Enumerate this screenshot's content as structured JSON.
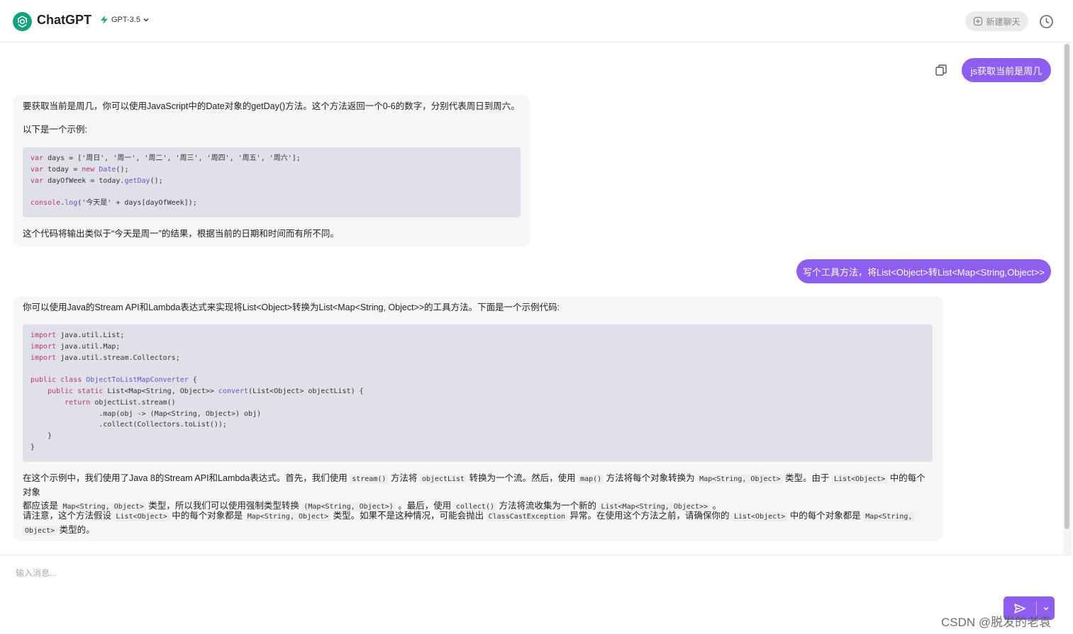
{
  "header": {
    "app_title": "ChatGPT",
    "model": "GPT-3.5",
    "new_chat": "新建聊天"
  },
  "messages": [
    {
      "role": "user",
      "text": "js获取当前是周几"
    },
    {
      "role": "assistant",
      "p1": "要获取当前是周几，你可以使用JavaScript中的Date对象的getDay()方法。这个方法返回一个0-6的数字，分别代表周日到周六。",
      "p2": "以下是一个示例:",
      "p3": "这个代码将输出类似于“今天是周一”的结果，根据当前的日期和时间而有所不同。"
    },
    {
      "role": "user",
      "text": "写个工具方法，将List<Object>转List<Map<String,Object>>"
    },
    {
      "role": "assistant",
      "p1": "你可以使用Java的Stream API和Lambda表达式来实现将List<Object>转换为List<Map<String, Object>>的工具方法。下面是一个示例代码:",
      "p2_a": "在这个示例中，我们使用了Java 8的Stream API和Lambda表达式。首先，我们使用",
      "p2_code1": "stream()",
      "p2_b": "方法将",
      "p2_code2": "objectList",
      "p2_c": "转换为一个流。然后，使用",
      "p2_code3": "map()",
      "p2_d": "方法将每个对象转换为",
      "p2_code4": "Map<String, Object>",
      "p2_e": "类型。由于",
      "p2_code5": "List<Object>",
      "p2_f": "中的每个对象",
      "p2_g": "都应该是",
      "p2_code6": "Map<String, Object>",
      "p2_h": "类型，所以我们可以使用强制类型转换",
      "p2_code7": "(Map<String, Object>)",
      "p2_i": "。最后，使用",
      "p2_code8": "collect()",
      "p2_j": "方法将流收集为一个新的",
      "p2_code9": "List<Map<String, Object>>",
      "p2_k": "。",
      "p3_a": "请注意，这个方法假设",
      "p3_code1": "List<Object>",
      "p3_b": "中的每个对象都是",
      "p3_code2": "Map<String, Object>",
      "p3_c": "类型。如果不是这种情况，可能会抛出",
      "p3_code3": "ClassCastException",
      "p3_d": "异常。在使用这个方法之前，请确保你的",
      "p3_code4": "List<Object>",
      "p3_e": "中的每个对象都是",
      "p3_code5": "Map<String,",
      "p3_code6": "Object>",
      "p3_f": "类型的。"
    }
  ],
  "code_js": {
    "l1_kw": "var",
    "l1_rest": " days = ['周日', '周一', '周二', '周三', '周四', '周五', '周六'];",
    "l2_kw": "var",
    "l2_a": " today = ",
    "l2_kw2": "new",
    "l2_fn": " Date",
    "l2_b": "();",
    "l3_kw": "var",
    "l3_a": " dayOfWeek = today.",
    "l3_fn": "getDay",
    "l3_b": "();",
    "l5_kw": "console",
    "l5_dot": ".",
    "l5_fn": "log",
    "l5_rest": "('今天是' + days[dayOfWeek]);"
  },
  "code_java": {
    "i1_kw": "import",
    "i1": " java.util.List;",
    "i2_kw": "import",
    "i2": " java.util.Map;",
    "i3_kw": "import",
    "i3": " java.util.stream.Collectors;",
    "c_kw": "public class",
    "c_name": " ObjectToListMapConverter",
    "c_rest": " {",
    "m_kw": "    public static",
    "m_a": " List<Map<String, Object>> ",
    "m_fn": "convert",
    "m_b": "(List<Object> objectList) {",
    "r_kw": "        return",
    "r_rest": " objectList.stream()",
    "map_line": "                .map(obj -> (Map<String, Object>) obj)",
    "collect_line": "                .collect(Collectors.toList());",
    "close1": "    }",
    "close2": "}"
  },
  "input": {
    "placeholder": "输入消息..."
  },
  "watermark": "CSDN @脱发的老袁",
  "colors": {
    "accent": "#8e5ef0",
    "logo": "#10a37f",
    "bubble_bg": "#f6f6f6",
    "code_bg": "#e0e0e8"
  },
  "icons": [
    "openai-logo-icon",
    "lightning-icon",
    "chevron-down-icon",
    "plus-square-icon",
    "clock-icon",
    "copy-icon",
    "send-icon"
  ]
}
